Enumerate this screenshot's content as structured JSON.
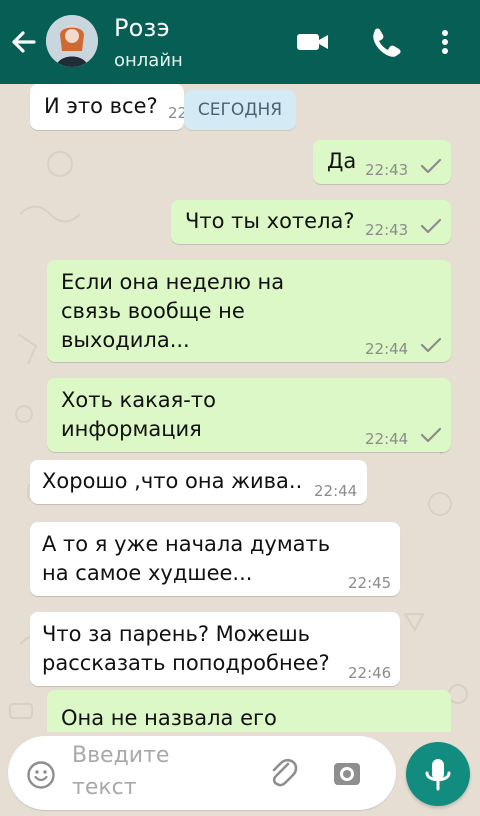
{
  "header": {
    "contact_name": "Розэ",
    "status": "онлайн",
    "icons": [
      "back-arrow-icon",
      "video-call-icon",
      "phone-icon",
      "more-icon"
    ]
  },
  "date_divider": "СЕГОДНЯ",
  "messages": [
    {
      "direction": "in",
      "text": "И это все?",
      "time": "22"
    },
    {
      "direction": "out",
      "text": "Да",
      "time": "22:43",
      "status": "sent"
    },
    {
      "direction": "out",
      "text": "Что ты хотела?",
      "time": "22:43",
      "status": "sent"
    },
    {
      "direction": "out",
      "text": "Если она неделю на\nсвязь вообще не\nвыходила...",
      "time": "22:44",
      "status": "sent"
    },
    {
      "direction": "out",
      "text": "Хоть какая-то\nинформация",
      "time": "22:44",
      "status": "sent"
    },
    {
      "direction": "in",
      "text": "Хорошо ,что она жива..",
      "time": "22:44"
    },
    {
      "direction": "in",
      "text": "А то я уже начала думать\nна самое худшее...",
      "time": "22:45"
    },
    {
      "direction": "in",
      "text": "Что за парень? Можешь\nрассказать поподробнее?",
      "time": "22:46"
    },
    {
      "direction": "out",
      "text": "Она не назвала его",
      "time": "",
      "status": ""
    }
  ],
  "composer": {
    "placeholder": "Введите\nтекст",
    "icons": [
      "emoji-icon",
      "attach-icon",
      "camera-icon",
      "microphone-icon"
    ]
  },
  "colors": {
    "header": "#075e54",
    "outgoing_bubble": "#dcf8c6",
    "incoming_bubble": "#ffffff",
    "chat_background": "#e6ded3",
    "mic_button": "#128c7e",
    "date_chip": "#d4eaf4"
  }
}
